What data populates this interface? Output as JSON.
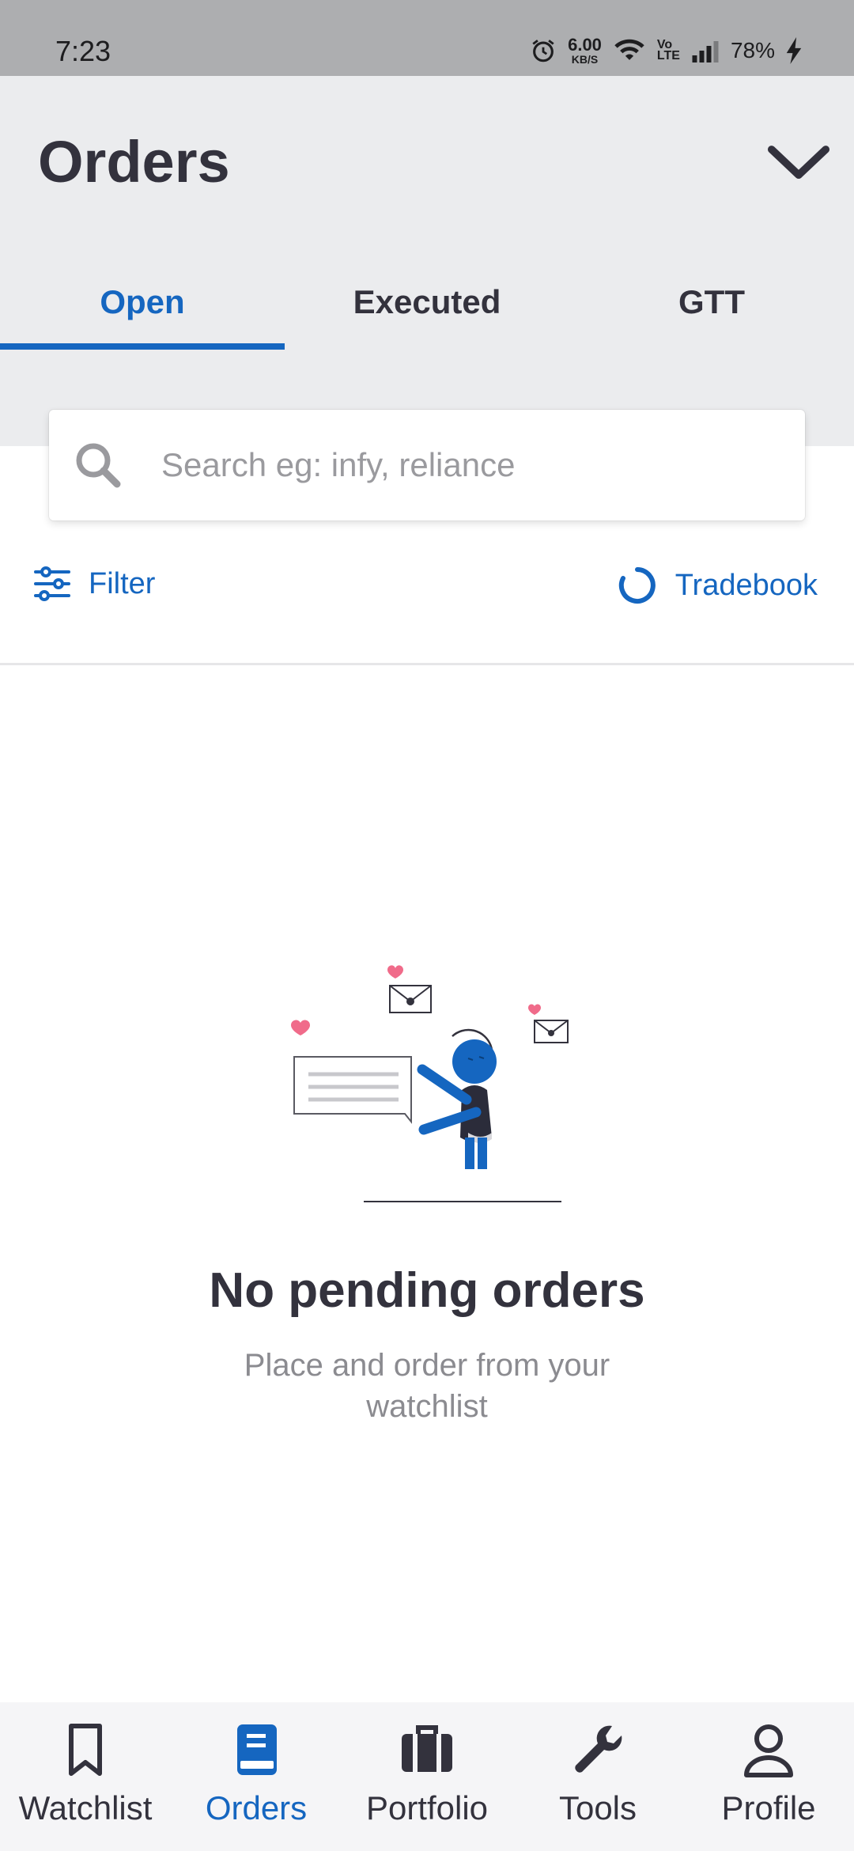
{
  "status_bar": {
    "time": "7:23",
    "net_speed_value": "6.00",
    "net_speed_unit": "KB/S",
    "volte_top": "Vo",
    "volte_bottom": "LTE",
    "battery": "78%"
  },
  "header": {
    "title": "Orders",
    "tabs": [
      {
        "label": "Open",
        "active": true
      },
      {
        "label": "Executed",
        "active": false
      },
      {
        "label": "GTT",
        "active": false
      }
    ]
  },
  "search": {
    "placeholder": "Search eg: infy, reliance",
    "value": ""
  },
  "actions": {
    "filter_label": "Filter",
    "tradebook_label": "Tradebook"
  },
  "empty_state": {
    "title": "No pending orders",
    "subtitle": "Place and order from your watchlist"
  },
  "bottom_nav": {
    "items": [
      {
        "label": "Watchlist",
        "icon": "bookmark-icon",
        "active": false
      },
      {
        "label": "Orders",
        "icon": "book-icon",
        "active": true
      },
      {
        "label": "Portfolio",
        "icon": "briefcase-icon",
        "active": false
      },
      {
        "label": "Tools",
        "icon": "wrench-icon",
        "active": false
      },
      {
        "label": "Profile",
        "icon": "user-icon",
        "active": false
      }
    ]
  },
  "colors": {
    "accent": "#1566c0",
    "text_dark": "#33323d",
    "header_bg": "#ebecee",
    "status_bar_bg": "#adaeb0",
    "heart": "#f06b8a"
  }
}
